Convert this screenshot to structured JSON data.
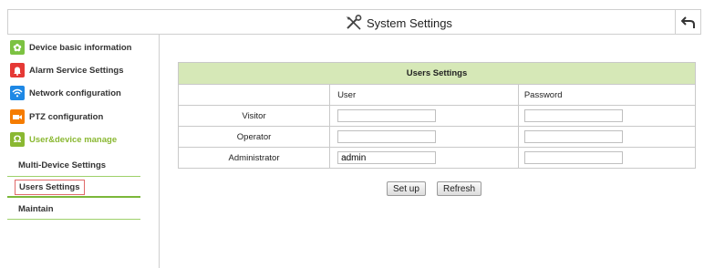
{
  "header": {
    "title": "System Settings",
    "tool_icon": "tools-icon",
    "back_icon": "back-arrow-icon"
  },
  "sidebar": {
    "items": [
      {
        "label": "Device basic information",
        "icon": "gear-icon",
        "color": "#7cc242"
      },
      {
        "label": "Alarm Service Settings",
        "icon": "bell-icon",
        "color": "#e53935"
      },
      {
        "label": "Network configuration",
        "icon": "wifi-icon",
        "color": "#1e88e5"
      },
      {
        "label": "PTZ configuration",
        "icon": "camera-icon",
        "color": "#f57c00"
      },
      {
        "label": "User&device manage",
        "icon": "user-icon",
        "color": "#8ab832"
      }
    ],
    "sub_items": [
      {
        "label": "Multi-Device Settings"
      },
      {
        "label": "Users Settings"
      },
      {
        "label": "Maintain"
      }
    ]
  },
  "users_settings": {
    "title": "Users Settings",
    "columns": [
      "User",
      "Password"
    ],
    "rows": [
      {
        "label": "Visitor",
        "user": "",
        "password": ""
      },
      {
        "label": "Operator",
        "user": "",
        "password": ""
      },
      {
        "label": "Administrator",
        "user": "admin",
        "password": ""
      }
    ]
  },
  "buttons": {
    "set_up": "Set up",
    "refresh": "Refresh"
  },
  "colors": {
    "accent_green": "#8ab832",
    "table_header": "#d6e8b7",
    "selected_border": "#e06a6a"
  }
}
